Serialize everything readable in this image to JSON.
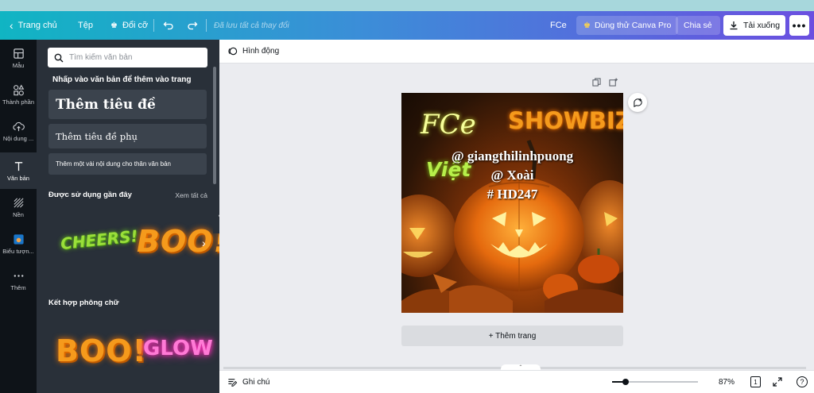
{
  "topbar": {
    "home": "Trang chủ",
    "file": "Tệp",
    "resize": "Đổi cỡ",
    "saved": "Đã lưu tất cả thay đổi",
    "design_name": "FCe",
    "pro": "Dùng thử Canva Pro",
    "share": "Chia sẻ",
    "download": "Tải xuống"
  },
  "rail": {
    "items": [
      {
        "label": "Mẫu",
        "icon": "template-icon"
      },
      {
        "label": "Thành phần",
        "icon": "elements-icon"
      },
      {
        "label": "Nội dung ...",
        "icon": "upload-icon"
      },
      {
        "label": "Văn bản",
        "icon": "text-icon"
      },
      {
        "label": "Nền",
        "icon": "background-icon"
      },
      {
        "label": "Biểu tượn...",
        "icon": "brand-logo-icon"
      },
      {
        "label": "Thêm",
        "icon": "more-icon"
      }
    ]
  },
  "panel": {
    "search_placeholder": "Tìm kiếm văn bản",
    "click_hint": "Nhấp vào văn bản để thêm vào trang",
    "add_heading": "Thêm tiêu đề",
    "add_subheading": "Thêm tiêu đề phụ",
    "add_body": "Thêm một vài nội dung cho thân văn bản",
    "recent": "Được sử dụng gần đây",
    "see_all": "Xem tất cả",
    "font_combos": "Kết hợp phông chữ",
    "stickers": [
      "CHEERS!",
      "BOO!",
      "BOO!",
      "GLOW"
    ]
  },
  "canvas": {
    "animate": "Hình động",
    "design_text": {
      "fce": "FCe",
      "showbiz": "SHOWBIZ",
      "viet": "Việt",
      "line1": "@ giangthilinhpuong",
      "line2": "@ Xoài",
      "line3": "# HD247"
    },
    "add_page": "+ Thêm trang"
  },
  "bottombar": {
    "notes": "Ghi chú",
    "zoom": "87%",
    "page_number": "1",
    "help": "?"
  },
  "colors": {
    "topbar_start": "#10b5c3",
    "topbar_end": "#6b4fe0",
    "rail_bg": "#0e1318",
    "panel_bg": "#293039"
  }
}
